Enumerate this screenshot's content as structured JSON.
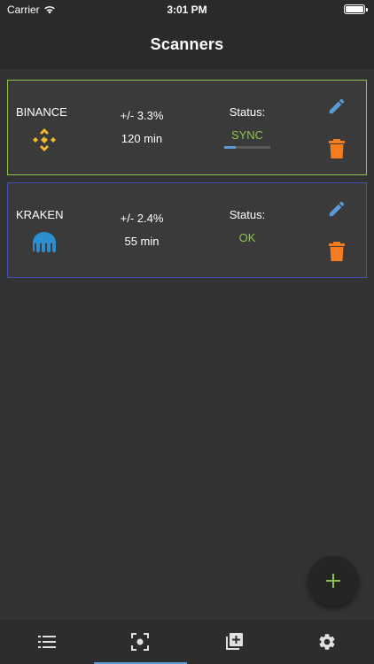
{
  "status_bar": {
    "carrier": "Carrier",
    "time": "3:01 PM"
  },
  "navbar": {
    "title": "Scanners"
  },
  "scanners": [
    {
      "exchange": "BINANCE",
      "threshold": "+/- 3.3%",
      "interval": "120 min",
      "status_label": "Status:",
      "status_value": "SYNC",
      "sync_progress": 0.25,
      "border_color": "#8bc34a",
      "logo_icon": "binance-logo-icon"
    },
    {
      "exchange": "KRAKEN",
      "threshold": "+/- 2.4%",
      "interval": "55 min",
      "status_label": "Status:",
      "status_value": "OK",
      "border_color": "#3f51b5",
      "logo_icon": "kraken-logo-icon"
    }
  ],
  "actions": {
    "edit_icon": "pencil-icon",
    "delete_icon": "trash-icon",
    "edit_color": "#5b9bd5",
    "delete_color": "#f57c1f"
  },
  "fab": {
    "icon": "plus-icon",
    "color": "#8bc34a"
  },
  "tabbar": {
    "tabs": [
      {
        "icon": "list-icon",
        "active": false
      },
      {
        "icon": "scanner-focus-icon",
        "active": true
      },
      {
        "icon": "add-to-library-icon",
        "active": false
      },
      {
        "icon": "gear-icon",
        "active": false
      }
    ],
    "active_color": "#5b9bd5"
  }
}
